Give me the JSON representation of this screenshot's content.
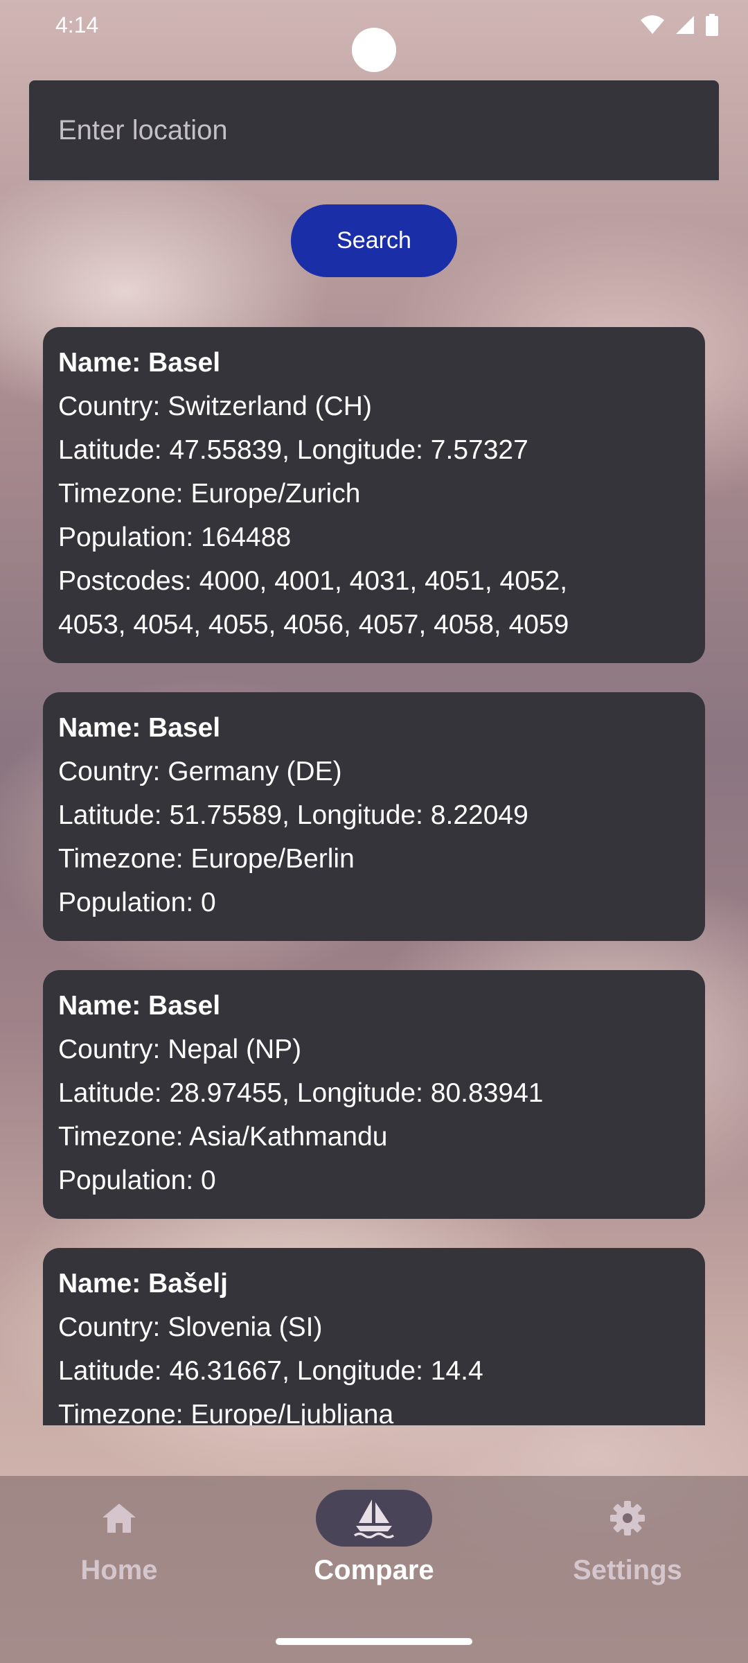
{
  "status_bar": {
    "time": "4:14",
    "icons": [
      "wifi-icon",
      "signal-icon",
      "battery-icon"
    ]
  },
  "search": {
    "placeholder": "Enter location",
    "value": "",
    "button_label": "Search"
  },
  "results": [
    {
      "name": "Name: Basel",
      "country": "Country: Switzerland (CH)",
      "coords": "Latitude: 47.55839, Longitude: 7.57327",
      "timezone": "Timezone: Europe/Zurich",
      "population": "Population: 164488",
      "postcodes_line1": "Postcodes: 4000, 4001, 4031, 4051, 4052,",
      "postcodes_line2": "4053, 4054, 4055, 4056, 4057, 4058, 4059"
    },
    {
      "name": "Name: Basel",
      "country": "Country: Germany (DE)",
      "coords": "Latitude: 51.75589, Longitude: 8.22049",
      "timezone": "Timezone: Europe/Berlin",
      "population": "Population: 0"
    },
    {
      "name": "Name: Basel",
      "country": "Country: Nepal (NP)",
      "coords": "Latitude: 28.97455, Longitude: 80.83941",
      "timezone": "Timezone: Asia/Kathmandu",
      "population": "Population: 0"
    },
    {
      "name": "Name: Bašelj",
      "country": "Country: Slovenia (SI)",
      "coords": "Latitude: 46.31667, Longitude: 14.4",
      "timezone": "Timezone: Europe/Ljubljana"
    }
  ],
  "nav": {
    "items": [
      {
        "label": "Home",
        "icon": "home-icon"
      },
      {
        "label": "Compare",
        "icon": "sailboat-icon",
        "active": true
      },
      {
        "label": "Settings",
        "icon": "gear-icon"
      }
    ]
  },
  "colors": {
    "card_bg": "#36343b",
    "button_bg": "#1a2ea8",
    "active_pill": "#4a4458"
  }
}
